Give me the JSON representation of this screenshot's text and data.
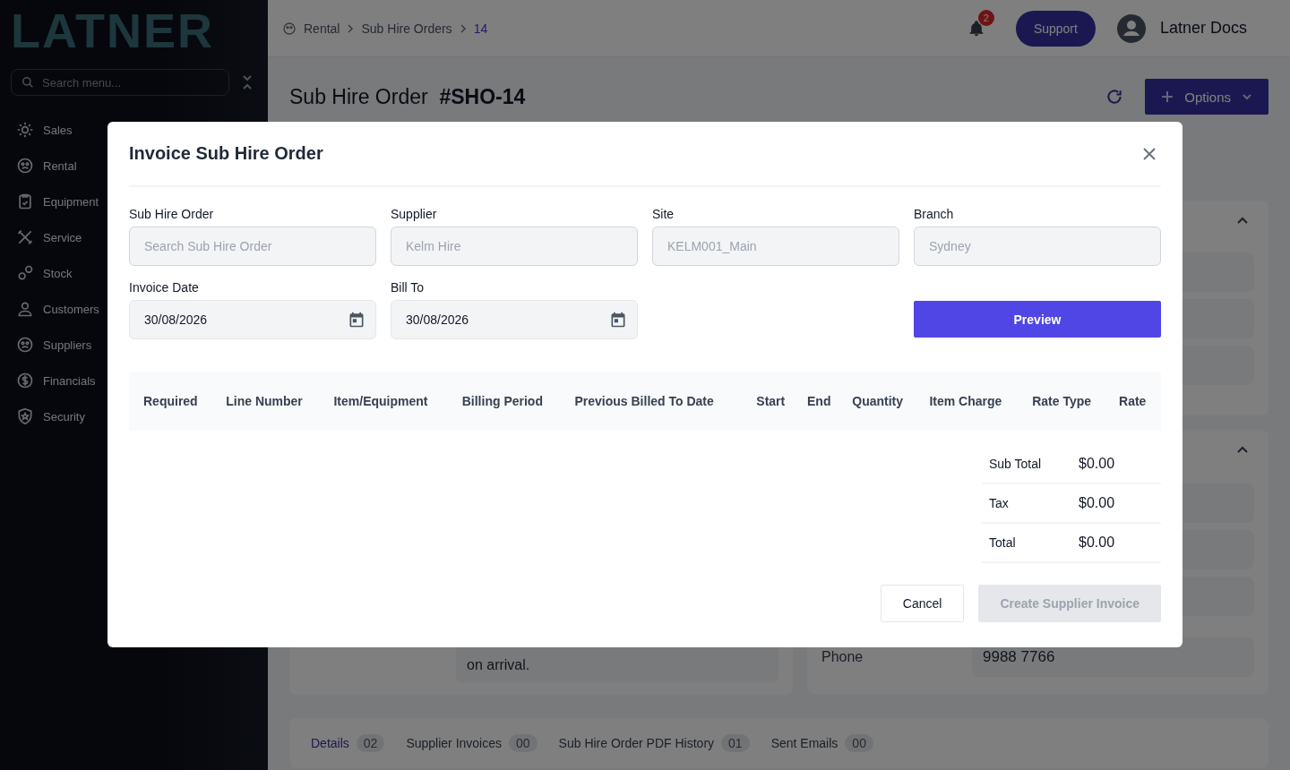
{
  "sidebar": {
    "logo": "LATNER",
    "search_placeholder": "Search menu...",
    "items": [
      {
        "label": "Sales"
      },
      {
        "label": "Rental"
      },
      {
        "label": "Equipment"
      },
      {
        "label": "Service"
      },
      {
        "label": "Stock"
      },
      {
        "label": "Customers"
      },
      {
        "label": "Suppliers"
      },
      {
        "label": "Financials"
      },
      {
        "label": "Security"
      }
    ]
  },
  "topbar": {
    "breadcrumb": [
      "Rental",
      "Sub Hire Orders",
      "14"
    ],
    "notifications": "2",
    "support": "Support",
    "user": "Latner Docs"
  },
  "page": {
    "title": "Sub Hire Order",
    "number": "#SHO-14",
    "options": "Options"
  },
  "background": {
    "notes_tail": "on arrival.",
    "phone_label": "Phone",
    "phone_value": "9988 7766"
  },
  "tabs": [
    {
      "label": "Details",
      "count": "02",
      "selected": true
    },
    {
      "label": "Supplier Invoices",
      "count": "00",
      "selected": false
    },
    {
      "label": "Sub Hire Order PDF History",
      "count": "01",
      "selected": false
    },
    {
      "label": "Sent Emails",
      "count": "00",
      "selected": false
    }
  ],
  "modal": {
    "title": "Invoice Sub Hire Order",
    "fields": [
      {
        "label": "Sub Hire Order",
        "kind": "text",
        "placeholder": "Search Sub Hire Order"
      },
      {
        "label": "Supplier",
        "kind": "text",
        "placeholder": "Kelm Hire"
      },
      {
        "label": "Site",
        "kind": "text",
        "placeholder": "KELM001_Main"
      },
      {
        "label": "Branch",
        "kind": "text",
        "placeholder": "Sydney"
      },
      {
        "label": "Invoice Date",
        "kind": "date",
        "value": "30/08/2026"
      },
      {
        "label": "Bill To",
        "kind": "date",
        "value": "30/08/2026"
      }
    ],
    "preview": "Preview",
    "columns": [
      "Required",
      "Line Number",
      "Item/Equipment",
      "Billing Period",
      "Previous Billed To Date",
      "Start",
      "End",
      "Quantity",
      "Item Charge",
      "Rate Type",
      "Rate"
    ],
    "totals": [
      {
        "label": "Sub Total",
        "value": "$0.00"
      },
      {
        "label": "Tax",
        "value": "$0.00"
      },
      {
        "label": "Total",
        "value": "$0.00"
      }
    ],
    "buttons": [
      {
        "label": "Cancel",
        "kind": "secondary",
        "disabled": false
      },
      {
        "label": "Create Supplier Invoice",
        "kind": "primary",
        "disabled": true
      }
    ]
  }
}
